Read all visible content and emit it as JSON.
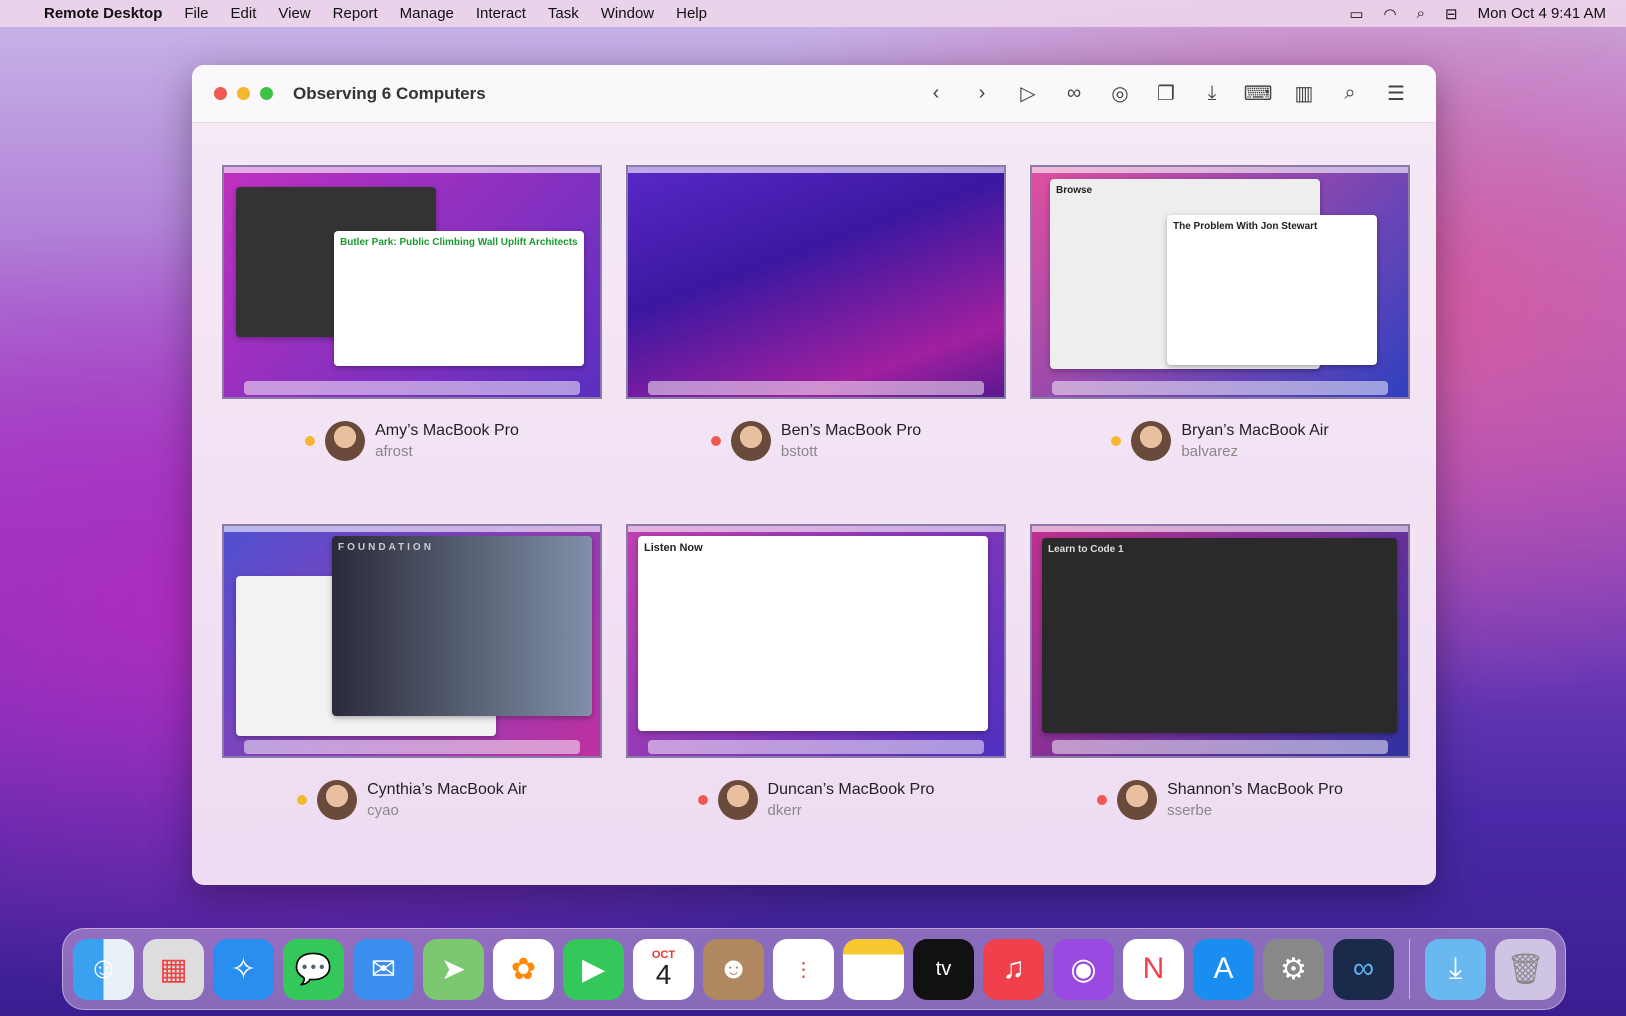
{
  "menubar": {
    "app": "Remote Desktop",
    "items": [
      "File",
      "Edit",
      "View",
      "Report",
      "Manage",
      "Interact",
      "Task",
      "Window",
      "Help"
    ],
    "clock": "Mon Oct 4  9:41 AM",
    "status_icons": [
      "battery-charging-icon",
      "wifi-icon",
      "spotlight-icon",
      "control-center-icon"
    ]
  },
  "window": {
    "title": "Observing 6 Computers",
    "toolbar": [
      "chevron-left-icon",
      "chevron-right-icon",
      "play-icon",
      "binoculars-icon",
      "control-icon",
      "copy-items-icon",
      "install-icon",
      "unix-command-icon",
      "report-icon",
      "search-icon",
      "list-view-icon"
    ]
  },
  "computers": [
    {
      "name": "Amy’s MacBook Pro",
      "user": "afrost",
      "status": "#f5b730",
      "screen_text": "Butler Park: Public Climbing Wall Uplift Architects"
    },
    {
      "name": "Ben’s MacBook Pro",
      "user": "bstott",
      "status": "#ee5a52",
      "screen_text": ""
    },
    {
      "name": "Bryan’s MacBook Air",
      "user": "balvarez",
      "status": "#f5b730",
      "screen_text": "The Problem With Jon Stewart"
    },
    {
      "name": "Cynthia’s MacBook Air",
      "user": "cyao",
      "status": "#f5b730",
      "screen_text": "FOUNDATION"
    },
    {
      "name": "Duncan’s MacBook Pro",
      "user": "dkerr",
      "status": "#ee5a52",
      "screen_text": "Listen Now"
    },
    {
      "name": "Shannon’s MacBook Pro",
      "user": "sserbe",
      "status": "#ee5a52",
      "screen_text": "Learn to Code 1"
    }
  ],
  "dock": {
    "calendar_month": "OCT",
    "calendar_day": "4",
    "apps": [
      "Finder",
      "Launchpad",
      "Safari",
      "Messages",
      "Mail",
      "Maps",
      "Photos",
      "FaceTime",
      "Calendar",
      "Contacts",
      "Reminders",
      "Notes",
      "TV",
      "Music",
      "Podcasts",
      "News",
      "App Store",
      "System Preferences",
      "Remote Desktop",
      "Downloads",
      "Trash"
    ]
  }
}
